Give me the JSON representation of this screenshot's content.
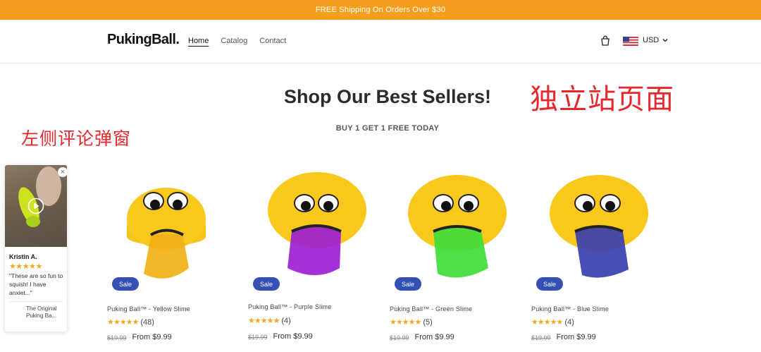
{
  "announcement": {
    "text": "FREE Shipping On Orders Over $30"
  },
  "header": {
    "logo": "PukingBall.",
    "nav": [
      {
        "label": "Home",
        "active": true
      },
      {
        "label": "Catalog",
        "active": false
      },
      {
        "label": "Contact",
        "active": false
      }
    ],
    "currency": "USD"
  },
  "main": {
    "title": "Shop Our Best Sellers!",
    "subtitle": "BUY 1 GET 1 FREE TODAY"
  },
  "annotations": {
    "right": "独立站页面",
    "left": "左侧评论弹窗"
  },
  "review_popup": {
    "name": "Kristin A.",
    "stars": "★★★★★",
    "review_text": "\"These are so fun to squish! I have anxiet...\"",
    "product_name": "The Original Puking Ba..."
  },
  "products": [
    {
      "title": "Puking Ball™ - Yellow Slime",
      "stars": "★★★★★",
      "count": "(48)",
      "old_price": "$19.99",
      "price": "From $9.99",
      "badge": "Sale",
      "slime_color": "#f0b117"
    },
    {
      "title": "Puking Ball™ - Purple Slime",
      "stars": "★★★★★",
      "count": "(4)",
      "old_price": "$19.99",
      "price": "From $9.99",
      "badge": "Sale",
      "slime_color": "#9b1fd1"
    },
    {
      "title": "Puking Ball™ - Green Slime",
      "stars": "★★★★★",
      "count": "(5)",
      "old_price": "$19.99",
      "price": "From $9.99",
      "badge": "Sale",
      "slime_color": "#3fdc3a"
    },
    {
      "title": "Puking Ball™ - Blue Slime",
      "stars": "★★★★★",
      "count": "(4)",
      "old_price": "$19.99",
      "price": "From $9.99",
      "badge": "Sale",
      "slime_color": "#3a3fb0"
    }
  ],
  "colors": {
    "announcement_bg": "#f59e1d",
    "sale_badge": "#3450b4",
    "star": "#f5a623",
    "annotation": "#e8262b",
    "ball": "#f7c21a"
  }
}
